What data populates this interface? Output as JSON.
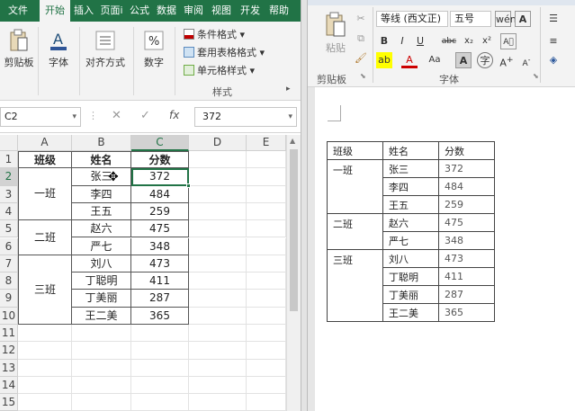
{
  "excel": {
    "tabs": [
      "文件",
      "开始",
      "插入",
      "页面i",
      "公式",
      "数据",
      "审阅",
      "视图",
      "开发",
      "帮助"
    ],
    "active_tab": "开始",
    "ribbon": {
      "clipboard": "剪贴板",
      "font": "字体",
      "alignment": "对齐方式",
      "number": "数字",
      "conditional_format": "条件格式",
      "table_format": "套用表格格式",
      "cell_style": "单元格样式",
      "styles_group": "样式"
    },
    "name_box": "C2",
    "formula_value": "372",
    "columns": [
      "A",
      "B",
      "C",
      "D",
      "E"
    ],
    "rows": [
      "1",
      "2",
      "3",
      "4",
      "5",
      "6",
      "7",
      "8",
      "9",
      "10",
      "11",
      "12",
      "13",
      "14",
      "15"
    ],
    "header": [
      "班级",
      "姓名",
      "分数"
    ],
    "groups": [
      {
        "class": "一班",
        "names": [
          "张三",
          "李四",
          "王五"
        ],
        "scores": [
          "372",
          "484",
          "259"
        ]
      },
      {
        "class": "二班",
        "names": [
          "赵六",
          "严七"
        ],
        "scores": [
          "475",
          "348"
        ]
      },
      {
        "class": "三班",
        "names": [
          "刘八",
          "丁聪明",
          "丁美丽",
          "王二美"
        ],
        "scores": [
          "473",
          "411",
          "287",
          "365"
        ]
      }
    ]
  },
  "word": {
    "font_name": "等线 (西文正)",
    "font_size": "五号",
    "clipboard_label": "剪贴板",
    "font_group_label": "字体",
    "paste_label": "粘贴",
    "table_header": [
      "班级",
      "姓名",
      "分数"
    ],
    "groups": [
      {
        "class": "一班",
        "names": [
          "张三",
          "李四",
          "王五"
        ],
        "scores": [
          "372",
          "484",
          "259"
        ]
      },
      {
        "class": "二班",
        "names": [
          "赵六",
          "严七"
        ],
        "scores": [
          "475",
          "348"
        ]
      },
      {
        "class": "三班",
        "names": [
          "刘八",
          "丁聪明",
          "丁美丽",
          "王二美"
        ],
        "scores": [
          "473",
          "411",
          "287",
          "365"
        ]
      }
    ]
  },
  "colors": {
    "excel_green": "#217346",
    "selection": "#217346",
    "word_blue": "#2b579a"
  }
}
